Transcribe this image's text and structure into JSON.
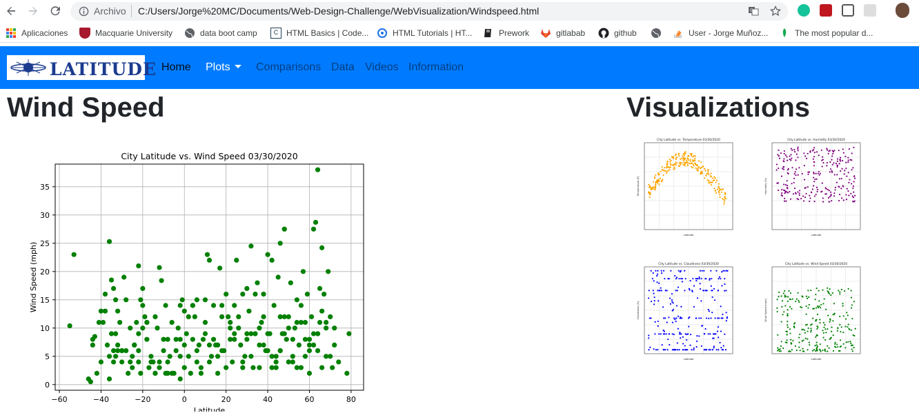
{
  "browser": {
    "scheme": "Archivo",
    "url": "C:/Users/Jorge%20MC/Documents/Web-Design-Challenge/WebVisualization/Windspeed.html",
    "bookmarks": [
      {
        "label": "Aplicaciones",
        "icon": "apps-grid-icon",
        "color": "#4285f4"
      },
      {
        "label": "Macquarie University",
        "icon": "macquarie-shield-icon",
        "color": "#a6192e"
      },
      {
        "label": "data boot camp",
        "icon": "globe-icon",
        "color": "#5f6368"
      },
      {
        "label": "HTML Basics | Code...",
        "icon": "codecademy-icon",
        "color": "#1f4056"
      },
      {
        "label": "HTML Tutorials | HT...",
        "icon": "tutorial-icon",
        "color": "#1a73e8"
      },
      {
        "label": "Prework",
        "icon": "book-icon",
        "color": "#202124"
      },
      {
        "label": "gitlabab",
        "icon": "gitlab-icon",
        "color": "#e24329"
      },
      {
        "label": "github",
        "icon": "github-icon",
        "color": "#202124"
      },
      {
        "label": "",
        "icon": "globe-icon",
        "color": "#5f6368"
      },
      {
        "label": "User - Jorge Muñoz...",
        "icon": "stackoverflow-icon",
        "color": "#f48024"
      },
      {
        "label": "The most popular d...",
        "icon": "mongodb-leaf-icon",
        "color": "#13aa52"
      }
    ]
  },
  "navbar": {
    "brand": "LATITUDE",
    "links": [
      "Home",
      "Plots",
      "Comparisons",
      "Data",
      "Videos",
      "Information"
    ]
  },
  "page": {
    "title": "Wind Speed",
    "side_title": "Visualizations"
  },
  "thumbnails": [
    {
      "title": "City Latitude vs. Temperature 03/30/2020",
      "color": "#ffa500",
      "ylabel": "Temperature (F)"
    },
    {
      "title": "City Latitude vs. Humidity 03/30/2020",
      "color": "#800080",
      "ylabel": "Humidity (%)"
    },
    {
      "title": "City Latitude vs. Cloudiness 03/30/2020",
      "color": "#0000ff",
      "ylabel": "Cloudiness (%)"
    },
    {
      "title": "City Latitude vs. Wind Speed 03/30/2020",
      "color": "#008000",
      "ylabel": "Wind Speed (mph)"
    }
  ],
  "chart_data": {
    "type": "scatter",
    "title": "City Latitude vs. Wind Speed 03/30/2020",
    "xlabel": "Latitude",
    "ylabel": "Wind Speed (mph)",
    "xlim": [
      -62,
      86
    ],
    "ylim": [
      -1,
      39
    ],
    "xticks": [
      -60,
      -40,
      -20,
      0,
      20,
      40,
      60,
      80
    ],
    "yticks": [
      0,
      5,
      10,
      15,
      20,
      25,
      30,
      35
    ],
    "grid": true,
    "color": "#008000",
    "x": [
      -55,
      -53,
      -46,
      -45,
      -44,
      -43,
      -42,
      -41,
      -40,
      -39,
      -38,
      -37,
      -36,
      -35,
      -35,
      -34,
      -34,
      -33,
      -33,
      -33,
      -32,
      -32,
      -31,
      -30,
      -29,
      -28,
      -27,
      -26,
      -25,
      -24,
      -23,
      -22,
      -22,
      -21,
      -21,
      -20,
      -20,
      -19,
      -18,
      -17,
      -16,
      -15,
      -14,
      -13,
      -12,
      -11,
      -10,
      -9,
      -9,
      -8,
      -7,
      -6,
      -5,
      -4,
      -3,
      -2,
      -2,
      -1,
      0,
      1,
      2,
      3,
      4,
      5,
      6,
      7,
      8,
      9,
      10,
      11,
      12,
      13,
      14,
      15,
      16,
      17,
      18,
      19,
      20,
      21,
      22,
      23,
      24,
      25,
      26,
      27,
      28,
      29,
      30,
      31,
      32,
      33,
      34,
      35,
      36,
      37,
      38,
      39,
      40,
      41,
      42,
      43,
      44,
      45,
      46,
      47,
      48,
      48,
      49,
      50,
      51,
      52,
      53,
      54,
      55,
      56,
      57,
      58,
      59,
      60,
      61,
      62,
      63,
      64,
      64,
      65,
      65,
      66,
      67,
      68,
      69,
      70,
      71,
      72,
      74,
      78,
      79,
      -40,
      -36,
      -30,
      -25,
      -18,
      -12,
      -6,
      0,
      6,
      12,
      18,
      24,
      30,
      36,
      42,
      48,
      54,
      60,
      66,
      -34,
      -28,
      -22,
      -14,
      -8,
      -2,
      4,
      10,
      16,
      22,
      28,
      34,
      40,
      46,
      52,
      58,
      64,
      70,
      -38,
      -26,
      -16,
      -4,
      8,
      14,
      26,
      38,
      44,
      50,
      56,
      62,
      68,
      -32,
      -20,
      -10,
      2,
      12,
      20,
      32,
      36,
      40,
      46,
      52,
      56,
      60,
      68,
      -24,
      -14,
      -2,
      6,
      18,
      28,
      34,
      42,
      50,
      58,
      62,
      66,
      -30,
      -18,
      -8,
      4,
      16,
      24,
      30,
      44,
      48,
      54,
      60,
      64,
      72,
      -44,
      -36,
      -22,
      -12,
      0,
      10,
      22,
      32,
      38,
      46,
      54,
      62,
      70
    ],
    "y": [
      10.4,
      23,
      1,
      0.5,
      8,
      8.5,
      2,
      11,
      4,
      11,
      16,
      7,
      25.3,
      18.5,
      9,
      17,
      4,
      15,
      9,
      5,
      13,
      7,
      11,
      4,
      19,
      6,
      2,
      4,
      3,
      7,
      11,
      21,
      6,
      15,
      2,
      17,
      10,
      12,
      8,
      3,
      5,
      4,
      2,
      10,
      20.7,
      18.4,
      6,
      2,
      14,
      4,
      5,
      11,
      2,
      8,
      10,
      1,
      14,
      15,
      3,
      9,
      5,
      2,
      14,
      12,
      4,
      7,
      3,
      8,
      11,
      23,
      22,
      5,
      14,
      7,
      2,
      20.6,
      14,
      6,
      3,
      12,
      8,
      4,
      9,
      22,
      10,
      7,
      16,
      5,
      8,
      13,
      24.5,
      3,
      9,
      18,
      7,
      11,
      16,
      6,
      23,
      9,
      22,
      14,
      3,
      19,
      25,
      9,
      27.5,
      27.5,
      8,
      12,
      18,
      5,
      10,
      15,
      7,
      14,
      20,
      8,
      16,
      6,
      12,
      27.5,
      28.7,
      38,
      9,
      17,
      11,
      24.2,
      16,
      5,
      20,
      12,
      3,
      7,
      4,
      2,
      9,
      13,
      1,
      6,
      5,
      11,
      3,
      2,
      7,
      6,
      4,
      12,
      8,
      17,
      10,
      5,
      9,
      11,
      7,
      3,
      6,
      15,
      4,
      2,
      8,
      5,
      14,
      9,
      7,
      10,
      3,
      16,
      6,
      12,
      8,
      11,
      9,
      5,
      13,
      10,
      4,
      6,
      2,
      8,
      12,
      7,
      5,
      4,
      3,
      9,
      11,
      6,
      14,
      8,
      12,
      7,
      16,
      5,
      3,
      9,
      6,
      4,
      11,
      2,
      10,
      7,
      12,
      8,
      15,
      6,
      4,
      9,
      3,
      10,
      5,
      7,
      13,
      6,
      11,
      2,
      8,
      5,
      14,
      9,
      4,
      12,
      3,
      8,
      6,
      10,
      7,
      5,
      9,
      4,
      13,
      15,
      11,
      9,
      12,
      6
    ]
  }
}
